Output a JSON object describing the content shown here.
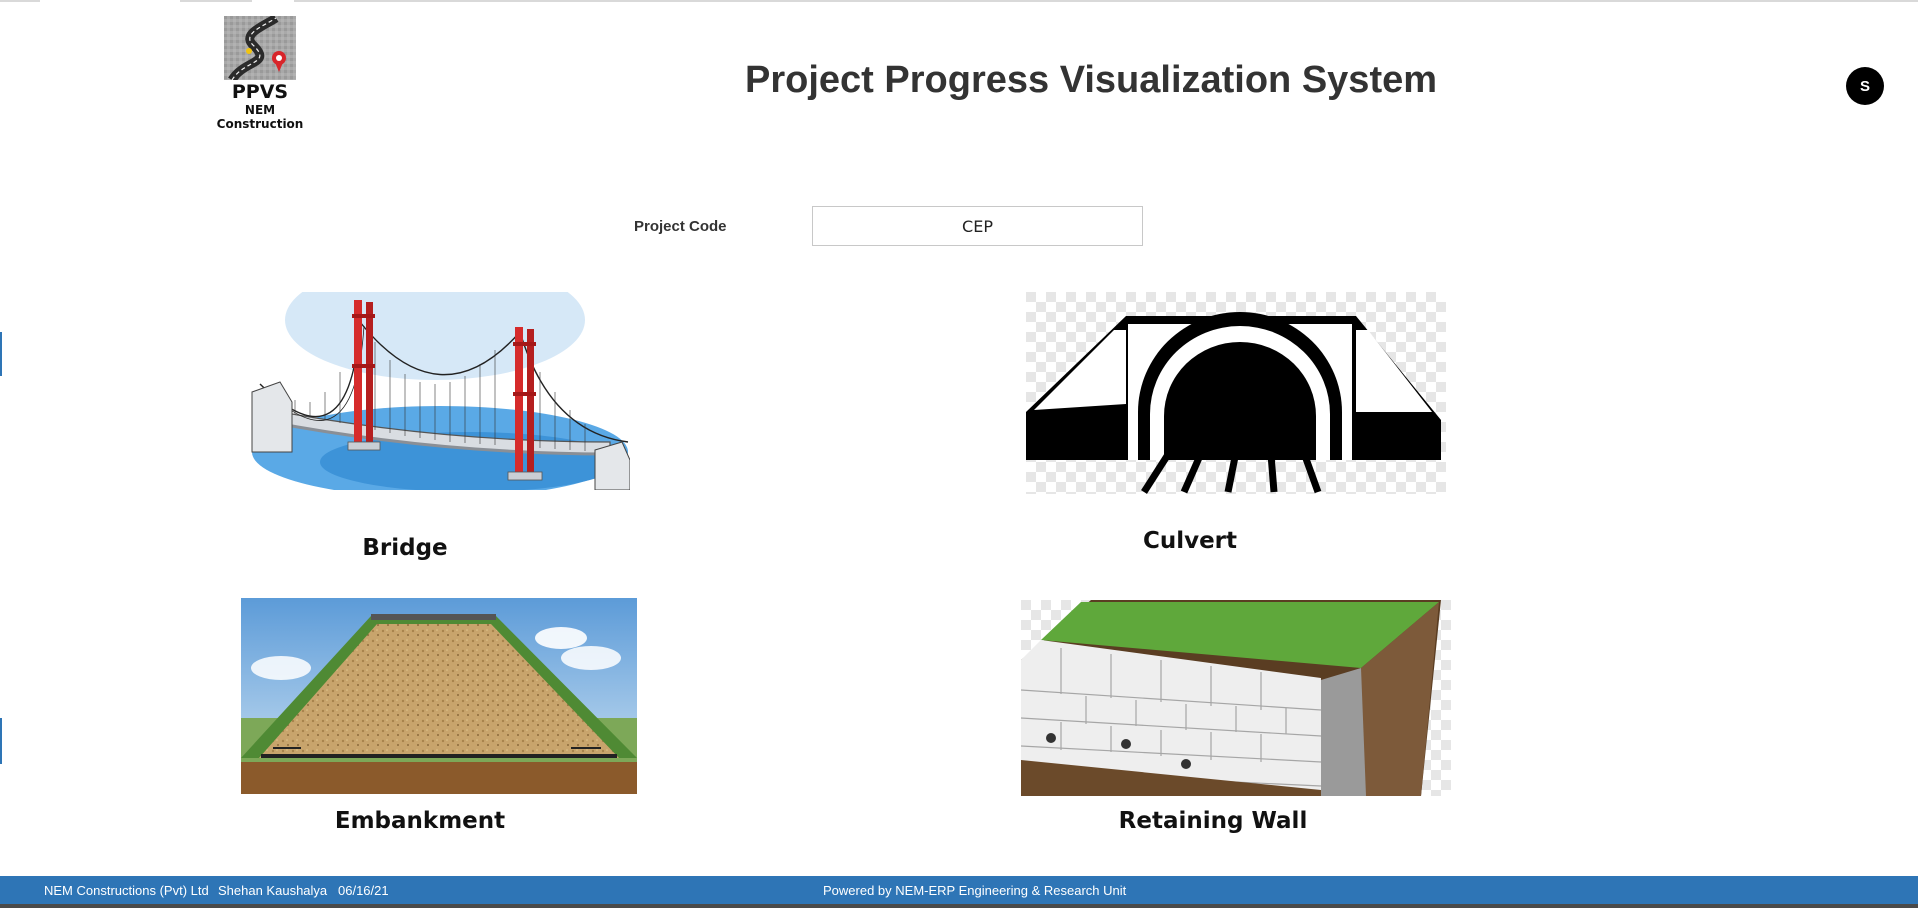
{
  "header": {
    "logo_abbr": "PPVS",
    "logo_company": "NEM Construction",
    "title": "Project Progress Visualization System",
    "avatar_initial": "S"
  },
  "project": {
    "code_label": "Project Code",
    "code_value": "CEP"
  },
  "structures": [
    {
      "label": "Bridge",
      "icon": "bridge-image"
    },
    {
      "label": "Culvert",
      "icon": "culvert-image"
    },
    {
      "label": "Embankment",
      "icon": "embankment-image"
    },
    {
      "label": "Retaining Wall",
      "icon": "retaining-wall-image"
    }
  ],
  "statusbar": {
    "company": "NEM Constructions (Pvt) Ltd",
    "user": "Shehan Kaushalya",
    "date": "06/16/21",
    "powered_by": "Powered by NEM-ERP Engineering & Research Unit"
  },
  "colors": {
    "statusbar": "#2e75b6",
    "title_text": "#333333",
    "bridge_tower": "#d62b2b",
    "water": "#4ea3e0"
  }
}
